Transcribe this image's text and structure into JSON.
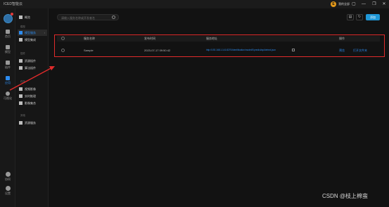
{
  "app": {
    "title": "ICED智能云",
    "user_label": "我的全部",
    "user_initial": "E"
  },
  "window_controls": [
    "▢",
    "—",
    "❐",
    "✕"
  ],
  "rail": {
    "items": [
      {
        "label": "首页",
        "icon": "home-icon"
      },
      {
        "label": "模型",
        "icon": "model-icon"
      },
      {
        "label": "插件",
        "icon": "plugin-icon"
      },
      {
        "label": "应用",
        "icon": "app-icon"
      },
      {
        "label": "可视化",
        "icon": "visual-icon"
      }
    ],
    "bottom": [
      {
        "label": "协同",
        "icon": "collab-icon"
      },
      {
        "label": "设置",
        "icon": "settings-icon"
      }
    ]
  },
  "sidebar": {
    "home": "概览",
    "groups": [
      {
        "title": "模型",
        "items": [
          {
            "label": "模型服务",
            "active": true,
            "chevron": "›"
          },
          {
            "label": "模型集成"
          }
        ]
      },
      {
        "title": "插件",
        "items": [
          {
            "label": "资源插件"
          },
          {
            "label": "算法插件"
          }
        ]
      },
      {
        "title": "任务",
        "items": [
          {
            "label": "视频影像"
          },
          {
            "label": "实时推理"
          },
          {
            "label": "影像集合"
          }
        ]
      },
      {
        "title": "其他",
        "items": [
          {
            "label": "资源服务"
          }
        ]
      }
    ]
  },
  "toolbar": {
    "search_placeholder": "请输入服务名称或开发者名",
    "add_label": "添加"
  },
  "table": {
    "headers": [
      "服务名称",
      "发布时间",
      "服务地址",
      "操作"
    ],
    "rows": [
      {
        "name": "Sample",
        "time": "2023-07-17 09:50:42",
        "address": "http://192.168.1.141:8270/identification/model/0/predict/api/detect.json",
        "actions": [
          "预览",
          "打开文件夹"
        ]
      }
    ]
  },
  "watermark": "CSDN @枝上棉蛮",
  "colors": {
    "accent": "#2d8cf0",
    "highlight_box": "#e02b2b",
    "add_button": "#1f97d7"
  }
}
